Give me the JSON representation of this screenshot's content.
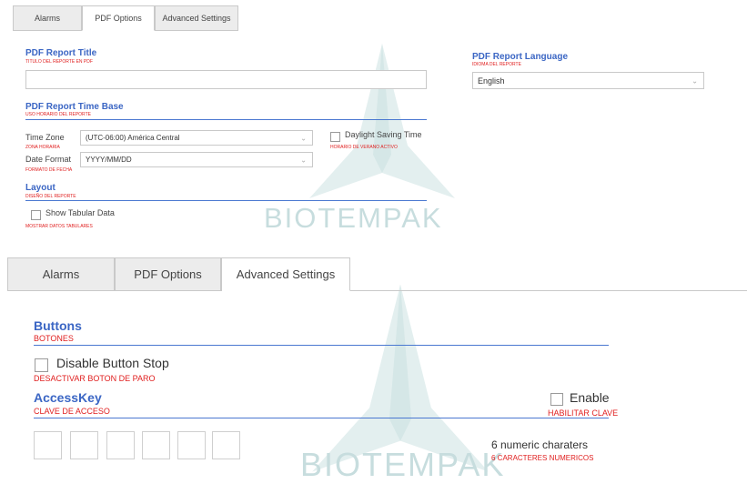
{
  "top_panel": {
    "tabs": [
      {
        "label": "Alarms"
      },
      {
        "label": "PDF Options"
      },
      {
        "label": "Advanced Settings"
      }
    ],
    "report_title": {
      "label": "PDF Report Title",
      "label_es": "TITULO DEL REPORTE EN PDF",
      "value": ""
    },
    "report_language": {
      "label": "PDF Report Language",
      "label_es": "IDIOMA DEL REPORTE",
      "value": "English"
    },
    "time_base": {
      "label": "PDF Report Time Base",
      "label_es": "USO HORARIO DEL REPORTE"
    },
    "time_zone": {
      "label": "Time Zone",
      "label_es": "ZONA HORARIA",
      "value": "(UTC-06:00) América Central"
    },
    "dst": {
      "label": "Daylight Saving Time",
      "label_es": "HORARIO DE VERANO ACTIVO",
      "checked": false
    },
    "date_format": {
      "label": "Date Format",
      "label_es": "FORMATO DE FECHA",
      "value": "YYYY/MM/DD"
    },
    "layout": {
      "label": "Layout",
      "label_es": "DISEÑO DEL REPORTE"
    },
    "tabular": {
      "label": "Show Tabular Data",
      "label_es": "MOSTRAR DATOS TABULARES",
      "checked": false
    },
    "watermark": "BIOTEMPAK"
  },
  "bottom_panel": {
    "tabs": [
      {
        "label": "Alarms"
      },
      {
        "label": "PDF Options"
      },
      {
        "label": "Advanced Settings"
      }
    ],
    "buttons": {
      "label": "Buttons",
      "label_es": "BOTONES"
    },
    "disable_stop": {
      "label": "Disable Button Stop",
      "label_es": "DESACTIVAR BOTON DE PARO",
      "checked": false
    },
    "access_key": {
      "label": "AccessKey",
      "label_es": "CLAVE DE ACCESO"
    },
    "enable": {
      "label": "Enable",
      "label_es": "HABILITAR CLAVE",
      "checked": false
    },
    "hint": {
      "label": "6 numeric charaters",
      "label_es": "6 CARACTERES NUMERICOS"
    },
    "digits": [
      "",
      "",
      "",
      "",
      "",
      ""
    ],
    "watermark": "BIOTEMPAK"
  },
  "colors": {
    "accent": "#3b66c4",
    "spanish": "#e01e1e",
    "watermark": "#c7ddde"
  }
}
